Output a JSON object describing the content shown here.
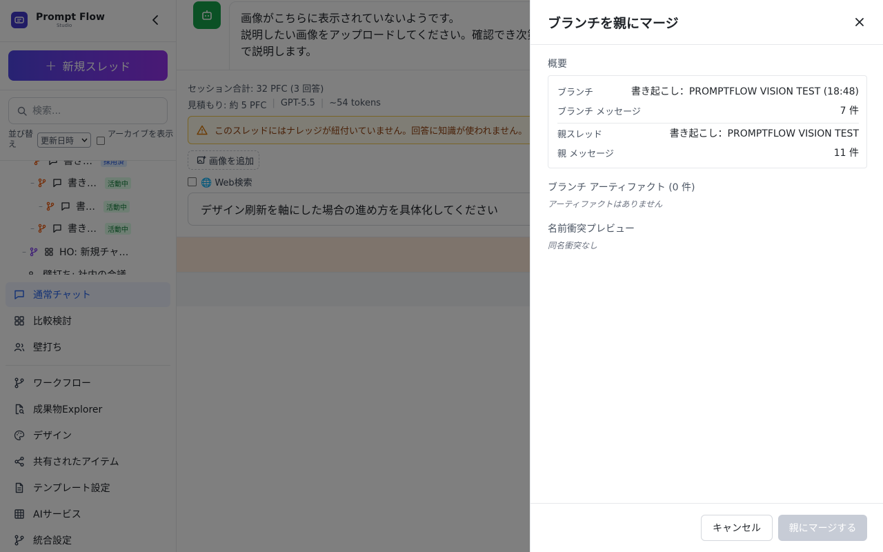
{
  "brand": {
    "title": "Prompt Flow",
    "subtitle": "Studio"
  },
  "sidebar": {
    "new_thread_label": "新規スレッド",
    "search_placeholder": "検索...",
    "sort_label": "並び替え",
    "sort_value": "更新日時",
    "archive_label": "アーカイブを表示",
    "tree": [
      {
        "label": "書き…",
        "badge": "採用済"
      },
      {
        "label": "書き…",
        "badge": "活動中"
      },
      {
        "label": "書…",
        "badge": "活動中"
      },
      {
        "label": "書き…",
        "badge": "活動中"
      },
      {
        "label": "HO: 新規チャ…"
      },
      {
        "label": "壁打ち: 社内の会議"
      }
    ],
    "nav_primary": [
      {
        "label": "通常チャット",
        "icon": "chat-icon"
      },
      {
        "label": "比較検討",
        "icon": "grid-icon"
      },
      {
        "label": "壁打ち",
        "icon": "users-icon"
      }
    ],
    "nav_secondary": [
      {
        "label": "ワークフロー",
        "icon": "workflow-icon"
      },
      {
        "label": "成果物Explorer",
        "icon": "file-search-icon"
      },
      {
        "label": "デザイン",
        "icon": "palette-icon"
      },
      {
        "label": "共有されたアイテム",
        "icon": "share-icon"
      },
      {
        "label": "テンプレート設定",
        "icon": "document-icon"
      },
      {
        "label": "AIサービス",
        "icon": "table-icon"
      },
      {
        "label": "統合設定",
        "icon": "branch-icon"
      }
    ]
  },
  "chat": {
    "message_lines": [
      "画像がこちらに表示されていないようです。",
      "説明したい画像をアップロードしてください。確認でき次第",
      "で説明します。"
    ],
    "session_total": "セッション合計: 32 PFC (3 回答)",
    "estimate": "見積もり: 約 5 PFC",
    "model": "GPT-5.5",
    "tokens": "~54 tokens",
    "warning": "このスレッドにはナレッジが紐付いていません。回答に知識が使われません。",
    "add_image_label": "画像を追加",
    "web_search_label": "🌐 Web検索",
    "prompt_text": "デザイン刷新を軸にした場合の進め方を具体化してください"
  },
  "drawer": {
    "title": "ブランチを親にマージ",
    "summary_label": "概要",
    "summary": {
      "branch_key": "ブランチ",
      "branch_value": "書き起こし：PROMPTFLOW VISION TEST (18:48)",
      "branch_msg_key": "ブランチ メッセージ",
      "branch_msg_value": "7 件",
      "parent_thread_key": "親スレッド",
      "parent_thread_value": "書き起こし：PROMPTFLOW VISION TEST",
      "parent_msg_key": "親 メッセージ",
      "parent_msg_value": "11 件"
    },
    "artifacts_label": "ブランチ アーティファクト (0 件)",
    "artifacts_empty": "アーティファクトはありません",
    "conflict_label": "名前衝突プレビュー",
    "conflict_empty": "同名衝突なし",
    "cancel_label": "キャンセル",
    "merge_label": "親にマージする"
  },
  "colors": {
    "accent": "#2563eb",
    "gradient_start": "#4f46e5",
    "gradient_end": "#9333ea",
    "bot_green": "#16a34a",
    "branch_orange": "#ea580c",
    "warning_bg": "#fffbeb",
    "warning_text": "#92400e"
  }
}
